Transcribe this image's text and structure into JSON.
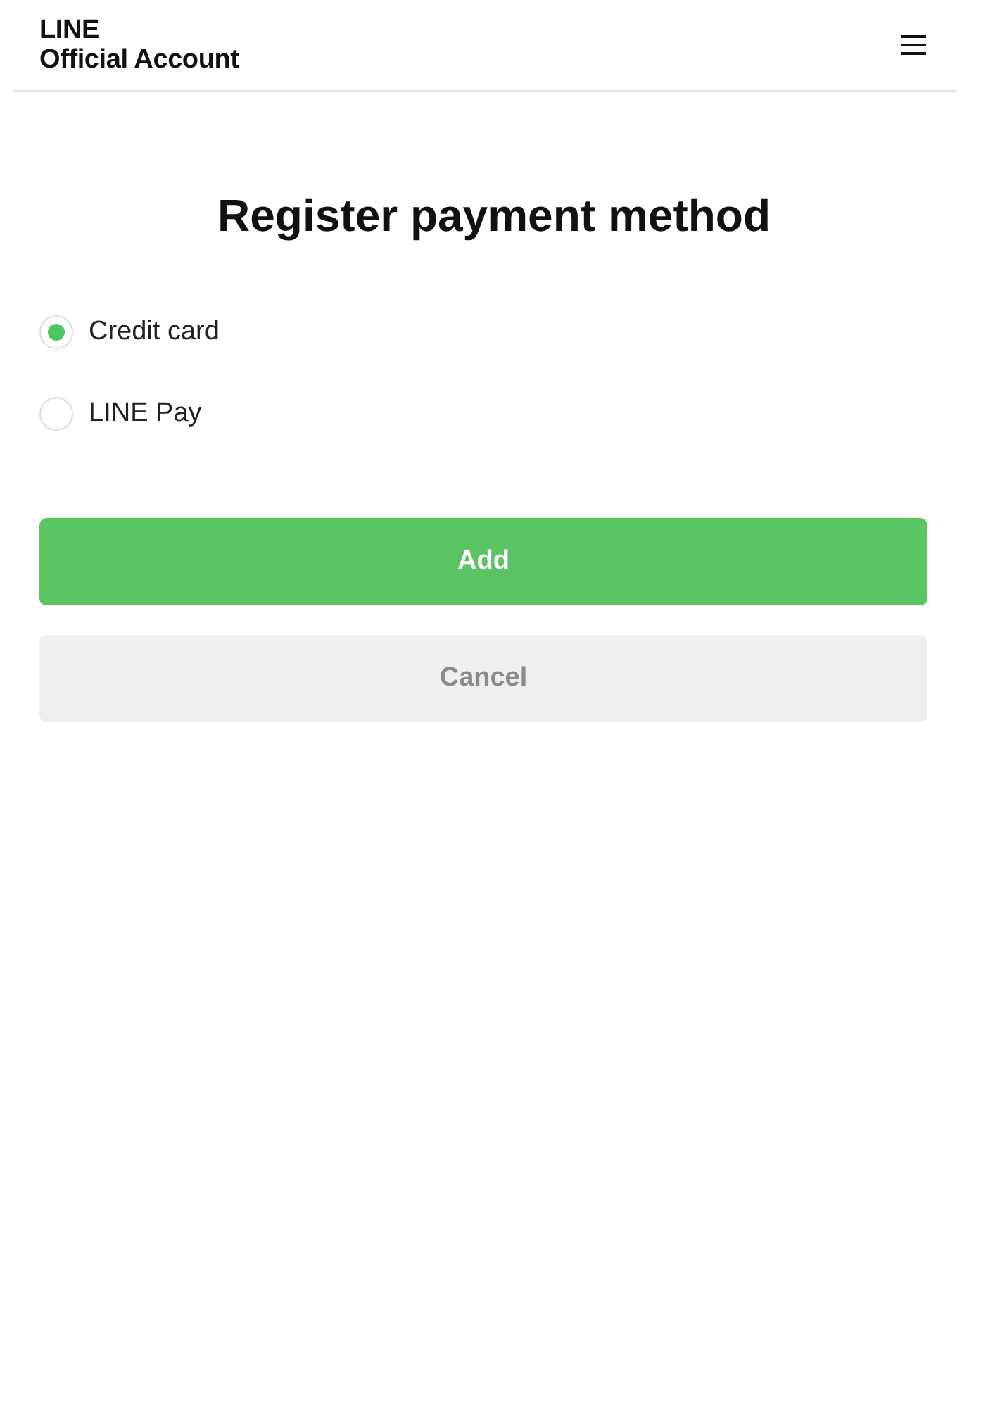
{
  "header": {
    "logo": [
      "LINE",
      "Official Account"
    ]
  },
  "title": "Register payment method",
  "payment_methods": [
    {
      "label": "Credit card",
      "selected": true
    },
    {
      "label": "LINE Pay",
      "selected": false
    }
  ],
  "buttons": [
    {
      "label": "Add",
      "kind": "primary"
    },
    {
      "label": "Cancel",
      "kind": "secondary"
    }
  ]
}
